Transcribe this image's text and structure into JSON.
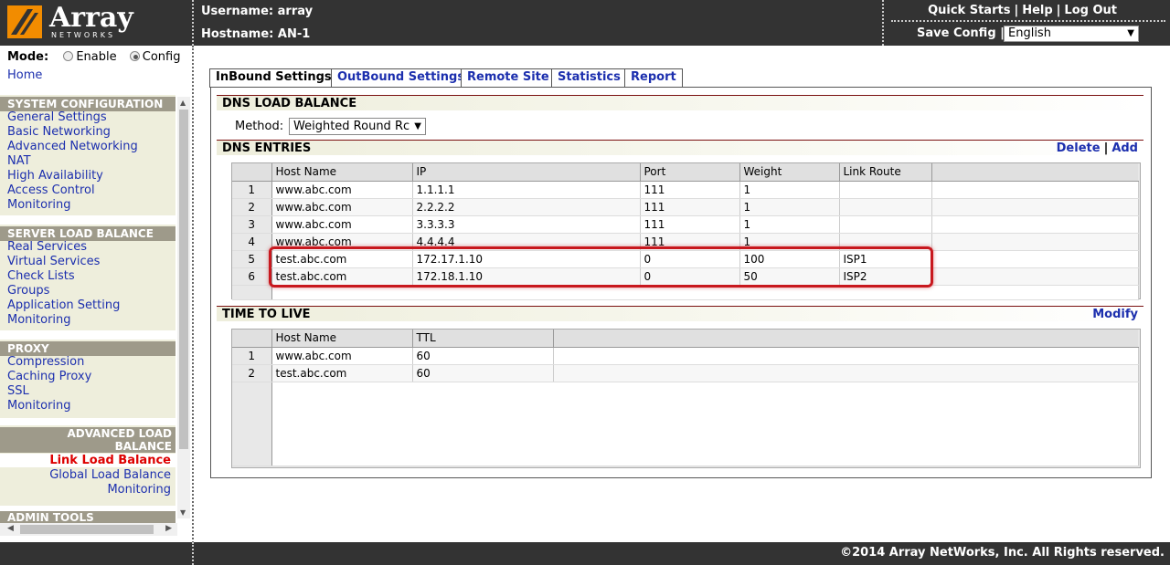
{
  "header": {
    "logo_text": "Array",
    "logo_sub": "NETWORKS",
    "username_label": "Username: array",
    "hostname_label": "Hostname: AN-1",
    "links": [
      "Quick Starts",
      "Help",
      "Log Out"
    ],
    "save_config": "Save Config",
    "language": "English"
  },
  "sidebar": {
    "mode_label": "Mode:",
    "mode_options": [
      "Enable",
      "Config"
    ],
    "home": "Home",
    "sections": [
      {
        "title": "SYSTEM CONFIGURATION",
        "items": [
          "General Settings",
          "Basic Networking",
          "Advanced Networking",
          "NAT",
          "High Availability",
          "Access Control",
          "Monitoring"
        ]
      },
      {
        "title": "SERVER LOAD BALANCE",
        "items": [
          "Real Services",
          "Virtual Services",
          "Check Lists",
          "Groups",
          "Application Setting",
          "Monitoring"
        ]
      },
      {
        "title": "PROXY",
        "items": [
          "Compression",
          "Caching Proxy",
          "SSL",
          "Monitoring"
        ]
      },
      {
        "title_line1": "ADVANCED LOAD",
        "title_line2": "BALANCE",
        "items": [
          "Link Load Balance",
          "Global Load Balance",
          "Monitoring"
        ]
      },
      {
        "title": "ADMIN TOOLS"
      }
    ]
  },
  "tabs": [
    "InBound Settings",
    "OutBound Settings",
    "Remote Site",
    "Statistics",
    "Report"
  ],
  "dns_lb": {
    "title": "DNS LOAD BALANCE",
    "method_label": "Method:",
    "method_value": "Weighted Round Rc"
  },
  "dns_entries": {
    "title": "DNS ENTRIES",
    "delete": "Delete",
    "add": "Add",
    "columns": [
      "Host Name",
      "IP",
      "Port",
      "Weight",
      "Link Route"
    ],
    "rows": [
      [
        "1",
        "www.abc.com",
        "1.1.1.1",
        "111",
        "1",
        ""
      ],
      [
        "2",
        "www.abc.com",
        "2.2.2.2",
        "111",
        "1",
        ""
      ],
      [
        "3",
        "www.abc.com",
        "3.3.3.3",
        "111",
        "1",
        ""
      ],
      [
        "4",
        "www.abc.com",
        "4.4.4.4",
        "111",
        "1",
        ""
      ],
      [
        "5",
        "test.abc.com",
        "172.17.1.10",
        "0",
        "100",
        "ISP1"
      ],
      [
        "6",
        "test.abc.com",
        "172.18.1.10",
        "0",
        "50",
        "ISP2"
      ]
    ]
  },
  "ttl": {
    "title": "TIME TO LIVE",
    "modify": "Modify",
    "columns": [
      "Host Name",
      "TTL"
    ],
    "rows": [
      [
        "1",
        "www.abc.com",
        "60"
      ],
      [
        "2",
        "test.abc.com",
        "60"
      ]
    ]
  },
  "footer": {
    "copyright": "©2014 Array NetWorks, Inc. All Rights reserved."
  }
}
